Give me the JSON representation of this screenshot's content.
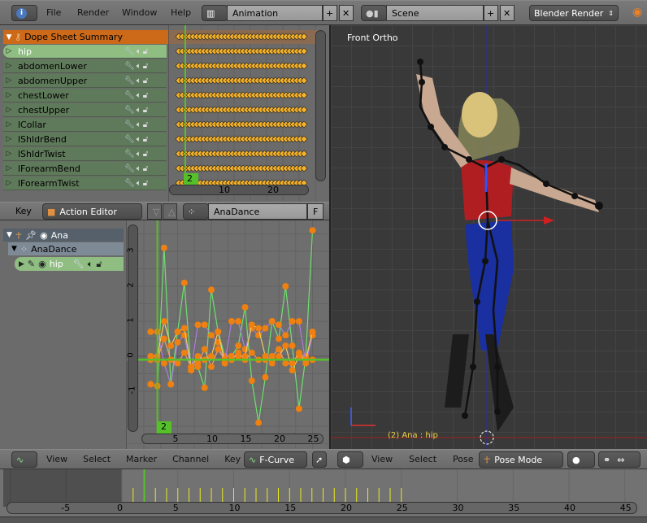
{
  "top_header": {
    "menu": [
      "File",
      "Render",
      "Window",
      "Help"
    ],
    "screen_layout": "Animation",
    "scene": "Scene",
    "render_engine": "Blender Render"
  },
  "dopesheet": {
    "summary": "Dope Sheet Summary",
    "channels": [
      "hip",
      "abdomenLower",
      "abdomenUpper",
      "chestLower",
      "chestUpper",
      "lCollar",
      "lShldrBend",
      "lShldrTwist",
      "lForearmBend",
      "lForearmTwist"
    ],
    "current_frame": "2",
    "ruler": [
      "10",
      "20"
    ],
    "header": {
      "key_menu": "Key",
      "mode": "Action Editor",
      "action": "AnaDance",
      "fake_user": "F"
    }
  },
  "graph": {
    "object": "Ana",
    "action": "AnaDance",
    "group": "hip",
    "y_ticks": [
      "3",
      "2",
      "1",
      "0",
      "-1"
    ],
    "x_ticks": [
      "5",
      "10",
      "15",
      "20",
      "25"
    ],
    "current_frame": "2",
    "curves": [
      {
        "color": "#6ee06e",
        "values": [
          -0.8,
          -0.85,
          3.1,
          -0.8,
          0.7,
          2.1,
          -0.4,
          -0.3,
          -0.9,
          1.9,
          0.7,
          0.0,
          0.0,
          0.3,
          1.4,
          -0.7,
          -1.9,
          -0.6,
          1.0,
          0.5,
          2.0,
          0.3,
          -1.5,
          0.0,
          3.6
        ]
      },
      {
        "color": "#b07ae0",
        "values": [
          0.7,
          0.7,
          -0.2,
          -0.8,
          0.4,
          0.6,
          -0.4,
          0.9,
          0.9,
          0.6,
          0.4,
          -0.2,
          1.0,
          1.0,
          0.2,
          0.8,
          0.6,
          0.8,
          1.0,
          0.9,
          0.6,
          1.0,
          1.0,
          -0.2,
          0.6
        ]
      },
      {
        "color": "#f0d060",
        "values": [
          0.0,
          0.0,
          1.0,
          0.3,
          0.7,
          0.8,
          -0.3,
          0.0,
          -0.1,
          0.0,
          0.7,
          -0.2,
          0.0,
          0.0,
          0.0,
          0.9,
          0.8,
          0.0,
          -0.2,
          0.0,
          0.3,
          -0.4,
          0.0,
          -0.1,
          0.7
        ]
      },
      {
        "color": "#f0a070",
        "values": [
          -0.1,
          -0.1,
          0.5,
          -0.1,
          -0.2,
          0.1,
          -0.3,
          -0.2,
          0.2,
          -0.3,
          0.2,
          -0.1,
          -0.1,
          0.1,
          -0.1,
          0.1,
          -0.1,
          -0.1,
          0.0,
          0.2,
          -0.2,
          -0.2,
          0.1,
          -0.1,
          -0.1
        ]
      }
    ],
    "header": {
      "menu": [
        "View",
        "Select",
        "Marker",
        "Channel",
        "Key"
      ],
      "mode": "F-Curve"
    }
  },
  "viewport": {
    "label": "Front Ortho",
    "status": "(2) Ana : hip",
    "header": {
      "menu": [
        "View",
        "Select",
        "Pose"
      ],
      "mode": "Pose Mode"
    }
  },
  "timeline": {
    "ticks": [
      "-5",
      "0",
      "5",
      "10",
      "15",
      "20",
      "25",
      "30",
      "35",
      "40",
      "45"
    ],
    "current_frame": 2,
    "keyframes": 25
  },
  "colors": {
    "summary": "#cc6a1a",
    "selected_channel": "#8fbd82",
    "channel": "#5f7a5a",
    "keyframe": "#f5b22a",
    "current_frame": "#55c02a",
    "viewport_bg": "#393939"
  }
}
